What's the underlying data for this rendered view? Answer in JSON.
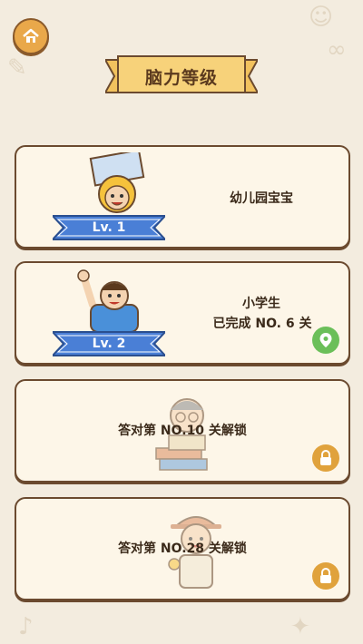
{
  "header": {
    "title": "脑力等级"
  },
  "levels": [
    {
      "lv": "Lv. 1",
      "name": "幼儿园宝宝"
    },
    {
      "lv": "Lv. 2",
      "name": "小学生",
      "status": "已完成 NO. 6 关"
    },
    {
      "unlock": "答对第 NO.10 关解锁"
    },
    {
      "unlock": "答对第 NO.28 关解锁"
    }
  ],
  "colors": {
    "ribbon_blue": "#4a7fd6",
    "badge_green": "#6bbf59",
    "badge_orange": "#e0a23c",
    "banner_yellow": "#f7d27a"
  },
  "icons": [
    "home-icon",
    "map-pin-icon",
    "lock-icon"
  ]
}
